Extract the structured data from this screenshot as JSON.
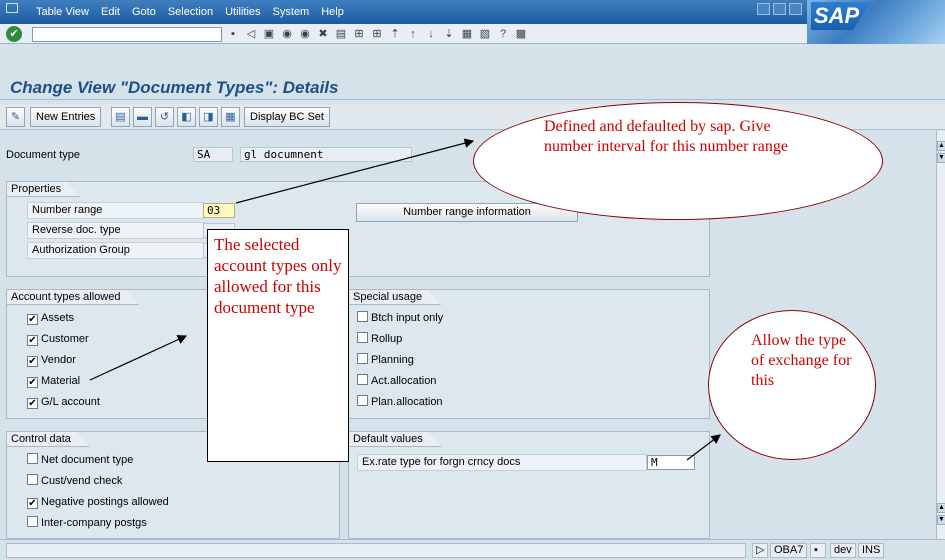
{
  "menu": {
    "items": [
      "Table View",
      "Edit",
      "Goto",
      "Selection",
      "Utilities",
      "System",
      "Help"
    ]
  },
  "logo": "SAP",
  "title": "Change View \"Document Types\": Details",
  "app_toolbar": {
    "new_entries": "New Entries",
    "display_bc_set": "Display BC Set"
  },
  "header": {
    "doc_type_label": "Document type",
    "doc_type_value": "SA",
    "doc_type_desc": "gl documnent"
  },
  "properties": {
    "title": "Properties",
    "number_range_label": "Number range",
    "number_range_value": "03",
    "reverse_label": "Reverse doc. type",
    "auth_group_label": "Authorization Group",
    "number_range_info_button": "Number range information"
  },
  "account_types": {
    "title": "Account types allowed",
    "items": [
      {
        "label": "Assets",
        "checked": "✔"
      },
      {
        "label": "Customer",
        "checked": "✔"
      },
      {
        "label": "Vendor",
        "checked": "✔"
      },
      {
        "label": "Material",
        "checked": "✔"
      },
      {
        "label": "G/L account",
        "checked": "✔"
      }
    ]
  },
  "special_usage": {
    "title": "Special usage",
    "items": [
      {
        "label": "Btch input only",
        "checked": ""
      },
      {
        "label": "Rollup",
        "checked": ""
      },
      {
        "label": "Planning",
        "checked": ""
      },
      {
        "label": "Act.allocation",
        "checked": ""
      },
      {
        "label": "Plan.allocation",
        "checked": ""
      }
    ]
  },
  "control_data": {
    "title": "Control data",
    "items": [
      {
        "label": "Net document type",
        "checked": ""
      },
      {
        "label": "Cust/vend check",
        "checked": ""
      },
      {
        "label": "Negative postings allowed",
        "checked": "✔"
      },
      {
        "label": "Inter-company postgs",
        "checked": ""
      }
    ]
  },
  "default_values": {
    "title": "Default values",
    "ex_rate_label": "Ex.rate type for forgn crncy docs",
    "ex_rate_value": "M"
  },
  "status_bar": {
    "transaction": "OBA7",
    "system": "dev",
    "mode": "INS"
  },
  "annotations": {
    "account_types_note": "The selected account types only allowed for this document type",
    "number_range_note": "Defined and defaulted by sap. Give number interval for this number range",
    "exchange_note": "Allow the type of exchange for this"
  },
  "icons": [
    "enter-icon",
    "save-icon",
    "back-icon",
    "exit-icon",
    "cancel-icon",
    "print-icon",
    "find-icon",
    "help-icon"
  ]
}
